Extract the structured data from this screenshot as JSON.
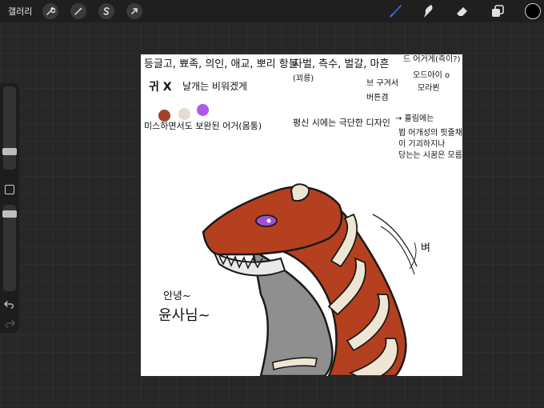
{
  "topbar": {
    "gallery_label": "갤러리",
    "left_tools": [
      "wrench-icon",
      "magic-wand-icon",
      "selection-s-icon",
      "arrow-transform-icon"
    ],
    "right_tools": [
      "brush-icon",
      "smudge-icon",
      "eraser-icon",
      "layers-icon"
    ],
    "active_color": "#000000",
    "active_tool_color": "#3b7df0"
  },
  "canvas_notes": {
    "line1": "등글고, 뾰족, 의인, 애교, 뽀리 항볼",
    "line2": "자벌, 측수, 벌갈, 마흔",
    "line2b": "(꾀릉)",
    "line3": "귀 X",
    "line3b": "날개는 비워겠게",
    "line4": "드 어거게(즉이?)",
    "line5": "오드아이 o",
    "line6": "모라뵌",
    "line7": "브 구겨서",
    "line8": "버튼겸",
    "line9": "미스하면서도 보완된 어거(몸통)",
    "line10": "평신 시에는 극단한 디자인",
    "line11": "→ 흘림에는",
    "line12": "뵙 어개성의 핏줄채",
    "line13": "이 기괴하지나",
    "line14": "당는는 시꿈은 모름",
    "greeting1": "안녕~",
    "greeting2": "윤사님~",
    "side_note": "벼"
  },
  "palette_dots": [
    "#a2402a",
    "#e4dccf",
    "#b058ea"
  ],
  "colors": {
    "dragon_red": "#b5401f",
    "dragon_gray": "#8f8f8f",
    "dragon_cream": "#efe5d3",
    "eye_purple": "#a04fd6"
  }
}
